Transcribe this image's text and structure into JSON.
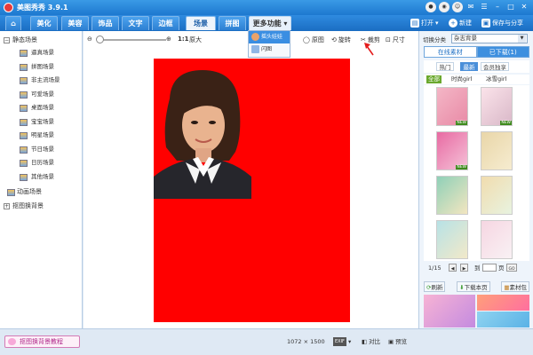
{
  "app": {
    "title": "美图秀秀 3.9.1"
  },
  "nav": {
    "tabs": [
      "美化",
      "美容",
      "饰品",
      "文字",
      "边框",
      "场景",
      "拼图"
    ],
    "more_label": "更多功能",
    "more_menu": [
      "摇头娃娃",
      "闪图"
    ],
    "open_label": "打开",
    "new_label": "新建",
    "save_label": "保存与分享"
  },
  "left": {
    "root1": "静态场景",
    "items": [
      "逼真场景",
      "拼图场景",
      "非主流场景",
      "可爱场景",
      "桌面场景",
      "宝宝场景",
      "明星场景",
      "节日场景",
      "日历场景",
      "其他场景"
    ],
    "root2": "动画场景",
    "root3": "抠图换背景"
  },
  "toolbar": {
    "ratio_label": "1:1",
    "original_size": "原大",
    "original_image": "原图",
    "rotate": "旋转",
    "crop": "裁剪",
    "size": "尺寸"
  },
  "right": {
    "category_label": "切换分类",
    "category_value": "杂志背景",
    "tab_online": "在线素材",
    "tab_downloaded": "已下载(1)",
    "sub_tabs": [
      "热门",
      "最新",
      "会员独享"
    ],
    "filters": [
      "全部",
      "时尚girl",
      "冰雪girl"
    ],
    "new_badge": "NEW",
    "page_info": "1/15",
    "goto_label": "到",
    "page_unit": "页",
    "go_label": "GO",
    "refresh": "刷新",
    "download_page": "下载本页",
    "material_pack": "素材包"
  },
  "bottom": {
    "tutorial": "抠图换背景教程",
    "dimensions": "1072 × 1500",
    "exif": "EXIF",
    "compare": "对比",
    "preview": "预览"
  },
  "colors": {
    "accent": "#1d78cf",
    "canvas_bg": "#ff0000",
    "new_badge": "#3f8a1e"
  }
}
